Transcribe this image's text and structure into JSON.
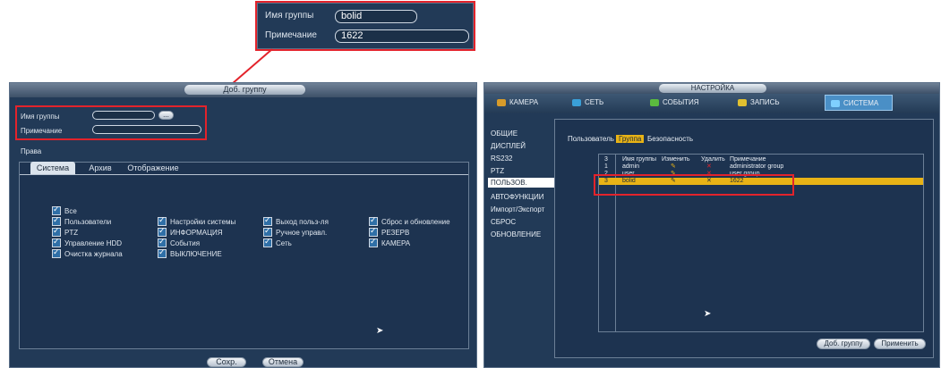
{
  "zoom": {
    "group_name_label": "Имя группы",
    "group_name_value": "bolid",
    "note_label": "Примечание",
    "note_value": "1622"
  },
  "add_group_dialog": {
    "title": "Доб. группу",
    "group_name_label": "Имя группы",
    "group_name_value": "",
    "group_name_btn": "...",
    "note_label": "Примечание",
    "note_value": "",
    "rights_label": "Права",
    "tabs": [
      "Система",
      "Архив",
      "Отображение"
    ],
    "permissions": [
      {
        "label": "Все"
      },
      {
        "label": "Пользователи"
      },
      {
        "label": "PTZ"
      },
      {
        "label": "Управление HDD"
      },
      {
        "label": "Очистка журнала"
      },
      {
        "label": "Настройки системы"
      },
      {
        "label": "ИНФОРМАЦИЯ"
      },
      {
        "label": "События"
      },
      {
        "label": "ВЫКЛЮЧЕНИЕ"
      },
      {
        "label": "Выход польз-ля"
      },
      {
        "label": "Ручное управл."
      },
      {
        "label": "Сеть"
      },
      {
        "label": "Сброс и обновление"
      },
      {
        "label": "РЕЗЕРВ"
      },
      {
        "label": "КАМЕРА"
      }
    ],
    "save_label": "Сохр.",
    "cancel_label": "Отмена"
  },
  "settings": {
    "title": "НАСТРОЙКА",
    "nav": [
      {
        "label": "КАМЕРА",
        "icon": "camera-icon",
        "color": "#d79b2a"
      },
      {
        "label": "СЕТЬ",
        "icon": "network-icon",
        "color": "#3aa0d8"
      },
      {
        "label": "СОБЫТИЯ",
        "icon": "events-icon",
        "color": "#5bbb3f"
      },
      {
        "label": "ЗАПИСЬ",
        "icon": "record-icon",
        "color": "#e0c030"
      },
      {
        "label": "СИСТЕМА",
        "icon": "system-icon",
        "color": "#3aa0d8"
      }
    ],
    "menu": [
      "ОБЩИЕ",
      "ДИСПЛЕЙ",
      "RS232",
      "PTZ",
      "ПОЛЬЗОВ.",
      "АВТОФУНКЦИИ",
      "Импорт/Экспорт",
      "СБРОС",
      "ОБНОВЛЕНИЕ"
    ],
    "active_menu": 4,
    "subtabs": [
      "Пользователь",
      "Группа",
      "Безопасность"
    ],
    "active_subtab": 1,
    "table_headers": {
      "count": "3",
      "name": "Имя группы",
      "edit": "Изменить",
      "delete": "Удалить",
      "note": "Примечание"
    },
    "rows": [
      {
        "num": "1",
        "name": "admin",
        "note": "administrator group"
      },
      {
        "num": "2",
        "name": "user",
        "note": "user group"
      },
      {
        "num": "3",
        "name": "bolid",
        "note": "1622"
      }
    ],
    "selected_row": 2,
    "add_group_label": "Доб. группу",
    "apply_label": "Применить"
  }
}
